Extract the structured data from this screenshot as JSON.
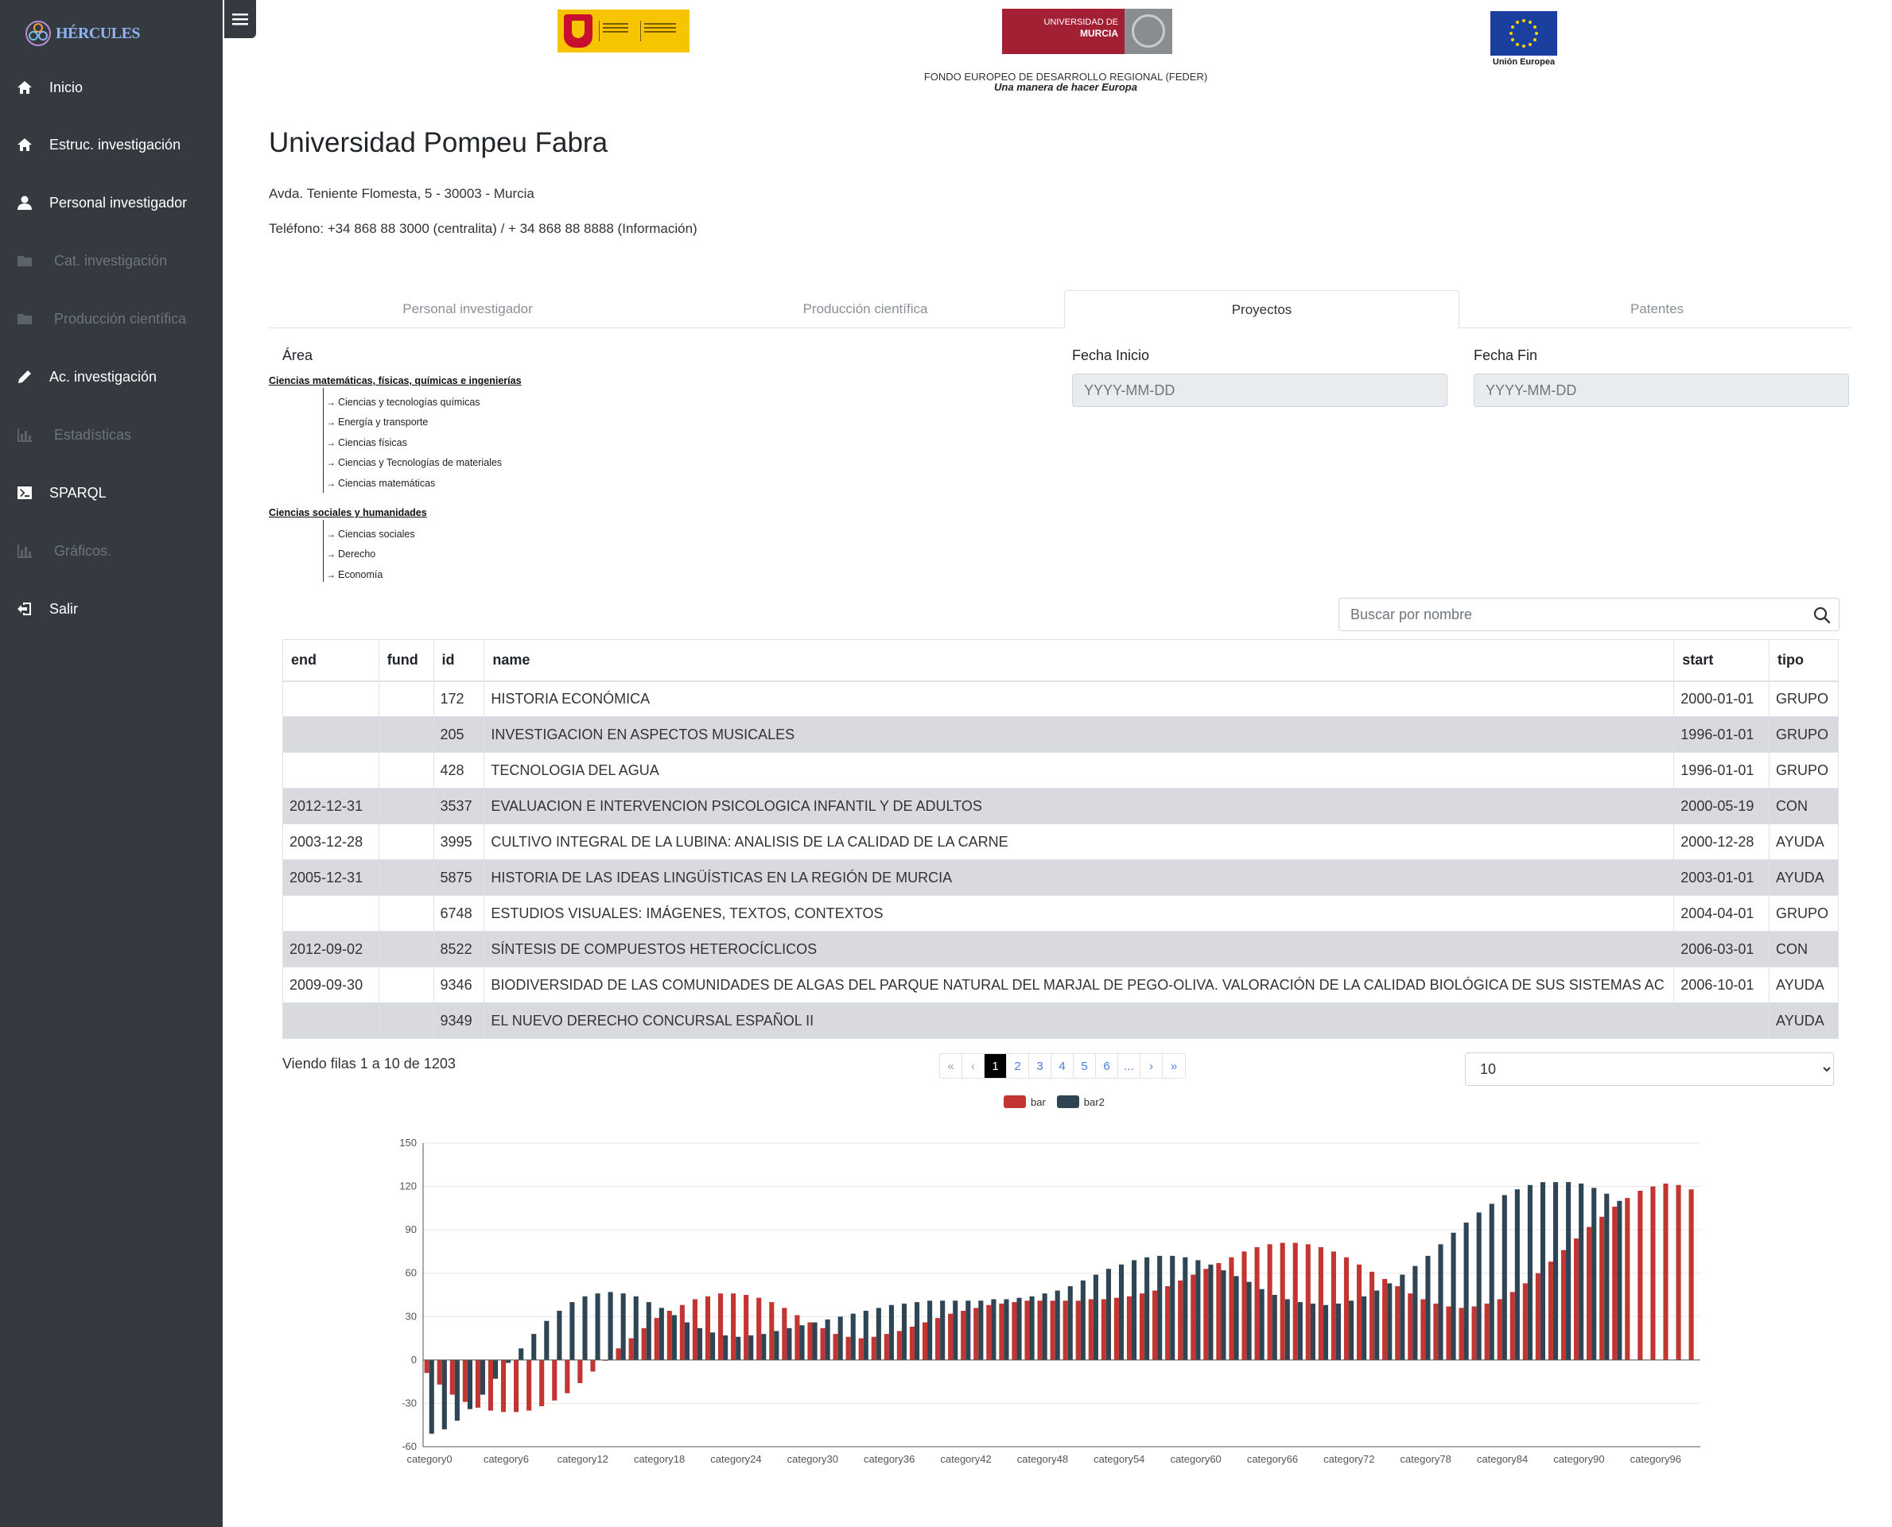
{
  "brand": {
    "name": "HÉRCULES"
  },
  "sidebar": {
    "items": [
      {
        "label": "Inicio",
        "icon": "home-icon",
        "enabled": true
      },
      {
        "label": "Estruc. investigación",
        "icon": "home-icon",
        "enabled": true
      },
      {
        "label": "Personal investigador",
        "icon": "user-icon",
        "enabled": true
      },
      {
        "label": "Cat. investigación",
        "icon": "folder-icon",
        "enabled": false
      },
      {
        "label": "Producción científica",
        "icon": "folder-icon",
        "enabled": false
      },
      {
        "label": "Ac. investigación",
        "icon": "pencil-icon",
        "enabled": true
      },
      {
        "label": "Estadísticas",
        "icon": "bar-chart-icon",
        "enabled": false
      },
      {
        "label": "SPARQL",
        "icon": "terminal-icon",
        "enabled": true
      },
      {
        "label": "Gráficos.",
        "icon": "bar-chart-icon",
        "enabled": false
      },
      {
        "label": "Salir",
        "icon": "sign-out-icon",
        "enabled": true
      }
    ]
  },
  "header": {
    "um_logo_line1": "UNIVERSIDAD DE",
    "um_logo_line2": "MURCIA",
    "ue_label": "Unión Europea",
    "feder_line1": "FONDO EUROPEO DE DESARROLLO REGIONAL (FEDER)",
    "feder_line2": "Una manera de hacer Europa"
  },
  "institution": {
    "name": "Universidad Pompeu Fabra",
    "address": "Avda. Teniente Flomesta, 5 - 30003 - Murcia",
    "phone": "Teléfono: +34 868 88 3000 (centralita) / + 34 868 88 8888 (Información)"
  },
  "tabs": [
    {
      "label": "Personal investigador",
      "active": false
    },
    {
      "label": "Producción científica",
      "active": false
    },
    {
      "label": "Proyectos",
      "active": true
    },
    {
      "label": "Patentes",
      "active": false
    }
  ],
  "filters": {
    "area_label": "Área",
    "fecha_inicio_label": "Fecha Inicio",
    "fecha_fin_label": "Fecha Fin",
    "date_placeholder": "YYYY-MM-DD",
    "search_placeholder": "Buscar por nombre"
  },
  "area_tree": [
    {
      "label": "Ciencias matemáticas, físicas, químicas e ingenierías",
      "children": [
        "Ciencias y tecnologías químicas",
        "Energía y transporte",
        "Ciencias físicas",
        "Ciencias y Tecnologías de materiales",
        "Ciencias matemáticas"
      ]
    },
    {
      "label": "Ciencias sociales y humanidades",
      "children": [
        "Ciencias sociales",
        "Derecho",
        "Economía"
      ]
    }
  ],
  "table": {
    "columns": [
      "end",
      "fund",
      "id",
      "name",
      "start",
      "tipo"
    ],
    "rows": [
      [
        "",
        "",
        "172",
        "HISTORIA ECONÓMICA",
        "2000-01-01",
        "GRUPO"
      ],
      [
        "",
        "",
        "205",
        "INVESTIGACION EN ASPECTOS MUSICALES",
        "1996-01-01",
        "GRUPO"
      ],
      [
        "",
        "",
        "428",
        "TECNOLOGIA DEL AGUA",
        "1996-01-01",
        "GRUPO"
      ],
      [
        "2012-12-31",
        "",
        "3537",
        "EVALUACION E INTERVENCION PSICOLOGICA INFANTIL Y DE ADULTOS",
        "2000-05-19",
        "CON"
      ],
      [
        "2003-12-28",
        "",
        "3995",
        "CULTIVO INTEGRAL DE LA LUBINA: ANALISIS DE LA CALIDAD DE LA CARNE",
        "2000-12-28",
        "AYUDA"
      ],
      [
        "2005-12-31",
        "",
        "5875",
        "HISTORIA DE LAS IDEAS LINGÜÍSTICAS EN LA REGIÓN DE MURCIA",
        "2003-01-01",
        "AYUDA"
      ],
      [
        "",
        "",
        "6748",
        "ESTUDIOS VISUALES: IMÁGENES, TEXTOS, CONTEXTOS",
        "2004-04-01",
        "GRUPO"
      ],
      [
        "2012-09-02",
        "",
        "8522",
        "SÍNTESIS DE COMPUESTOS HETEROCÍCLICOS",
        "2006-03-01",
        "CON"
      ],
      [
        "2009-09-30",
        "",
        "9346",
        "BIODIVERSIDAD DE LAS COMUNIDADES DE ALGAS DEL PARQUE NATURAL DEL MARJAL DE PEGO-OLIVA. VALORACIÓN DE LA CALIDAD BIOLÓGICA DE SUS SISTEMAS AC",
        "2006-10-01",
        "AYUDA"
      ],
      [
        "",
        "",
        "9349",
        "EL NUEVO DERECHO CONCURSAL ESPAÑOL II",
        "",
        "AYUDA"
      ]
    ]
  },
  "pagination": {
    "info": "Viendo filas 1 a 10 de 1203",
    "buttons": [
      "«",
      "‹",
      "1",
      "2",
      "3",
      "4",
      "5",
      "6",
      "...",
      "›",
      "»"
    ],
    "active_page": "1",
    "page_size": "10"
  },
  "chart_data": {
    "type": "bar",
    "x_tick_labels": [
      "category0",
      "category6",
      "category12",
      "category18",
      "category24",
      "category30",
      "category36",
      "category42",
      "category48",
      "category54",
      "category60",
      "category66",
      "category72",
      "category78",
      "category84",
      "category90",
      "category96"
    ],
    "y_ticks": [
      150,
      120,
      90,
      60,
      30,
      0,
      -30,
      -60
    ],
    "ylim": [
      -60,
      150
    ],
    "legend_placement": "top-center",
    "series": [
      {
        "name": "bar",
        "color": "#c23531",
        "values": [
          -9,
          -17,
          -24,
          -29,
          -33,
          -35,
          -36,
          -36,
          -35,
          -32,
          -28,
          -23,
          -16,
          -8,
          0,
          8,
          15,
          22,
          29,
          34,
          38,
          42,
          44,
          46,
          46,
          45,
          43,
          40,
          36,
          31,
          26,
          22,
          18,
          16,
          15,
          16,
          18,
          20,
          23,
          26,
          29,
          32,
          34,
          36,
          38,
          39,
          40,
          41,
          41,
          41,
          41,
          41,
          42,
          42,
          43,
          44,
          46,
          48,
          51,
          55,
          59,
          63,
          67,
          71,
          75,
          78,
          80,
          81,
          81,
          80,
          78,
          75,
          71,
          66,
          61,
          56,
          51,
          46,
          42,
          39,
          37,
          36,
          37,
          39,
          42,
          47,
          53,
          60,
          68,
          76,
          84,
          92,
          99,
          106,
          112,
          117,
          120,
          122,
          121,
          118
        ]
      },
      {
        "name": "bar2",
        "color": "#2f4554",
        "values": [
          -51,
          -48,
          -42,
          -34,
          -24,
          -13,
          -2,
          8,
          18,
          27,
          34,
          40,
          44,
          46,
          47,
          46,
          44,
          40,
          36,
          31,
          26,
          22,
          19,
          17,
          16,
          17,
          18,
          20,
          22,
          24,
          26,
          28,
          30,
          32,
          34,
          36,
          38,
          39,
          40,
          41,
          41,
          41,
          41,
          41,
          42,
          42,
          43,
          44,
          46,
          48,
          51,
          55,
          59,
          63,
          66,
          69,
          71,
          72,
          72,
          71,
          69,
          66,
          62,
          58,
          54,
          49,
          45,
          42,
          40,
          39,
          38,
          39,
          41,
          44,
          48,
          53,
          59,
          65,
          72,
          80,
          88,
          95,
          102,
          108,
          114,
          118,
          121,
          123,
          123,
          123,
          122,
          119,
          115,
          110
        ]
      }
    ]
  }
}
